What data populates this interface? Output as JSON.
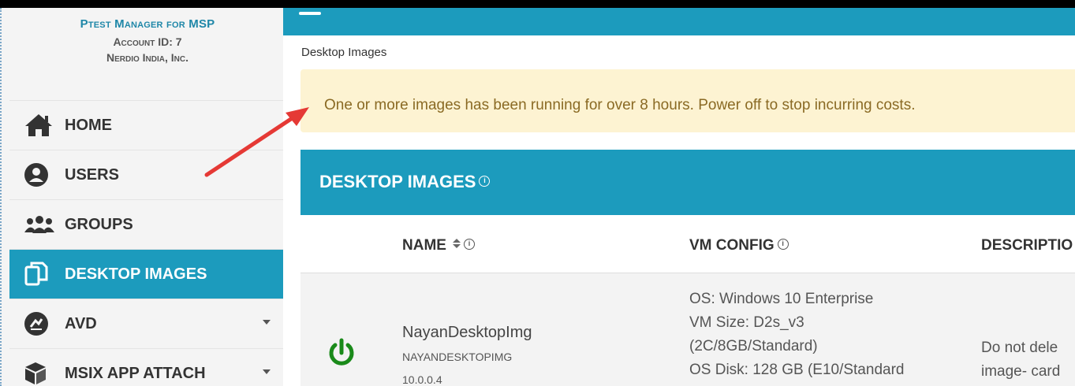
{
  "account": {
    "title": "Ptest Manager for MSP",
    "account_id": "Account ID: 7",
    "org": "Nerdio India, Inc."
  },
  "nav": {
    "items": [
      {
        "label": "HOME",
        "icon": "home-icon"
      },
      {
        "label": "USERS",
        "icon": "user-icon"
      },
      {
        "label": "GROUPS",
        "icon": "groups-icon"
      },
      {
        "label": "DESKTOP IMAGES",
        "icon": "copy-icon"
      },
      {
        "label": "AVD",
        "icon": "avd-icon"
      },
      {
        "label": "MSIX APP ATTACH",
        "icon": "box-icon"
      }
    ],
    "active_index": 3
  },
  "breadcrumb": "Desktop Images",
  "alert": {
    "text": "One or more images has been running for over 8 hours. Power off to stop incurring costs."
  },
  "panel": {
    "title": "DESKTOP IMAGES",
    "columns": [
      "NAME",
      "VM CONFIG",
      "DESCRIPTIO"
    ]
  },
  "rows": [
    {
      "name": "NayanDesktopImg",
      "name_upper": "NAYANDESKTOPIMG",
      "version": "10.0.0.4",
      "vm_config": [
        "OS: Windows 10 Enterprise",
        "VM Size: D2s_v3",
        "(2C/8GB/Standard)",
        "OS Disk: 128 GB (E10/Standard"
      ],
      "description": [
        "Do not dele",
        "image- card"
      ]
    }
  ],
  "colors": {
    "accent": "#1c9bbd",
    "alert_bg": "#fdf3d2",
    "alert_text": "#8a6a24",
    "power_on": "#1a8a1a",
    "annotation_arrow": "#e53935"
  }
}
